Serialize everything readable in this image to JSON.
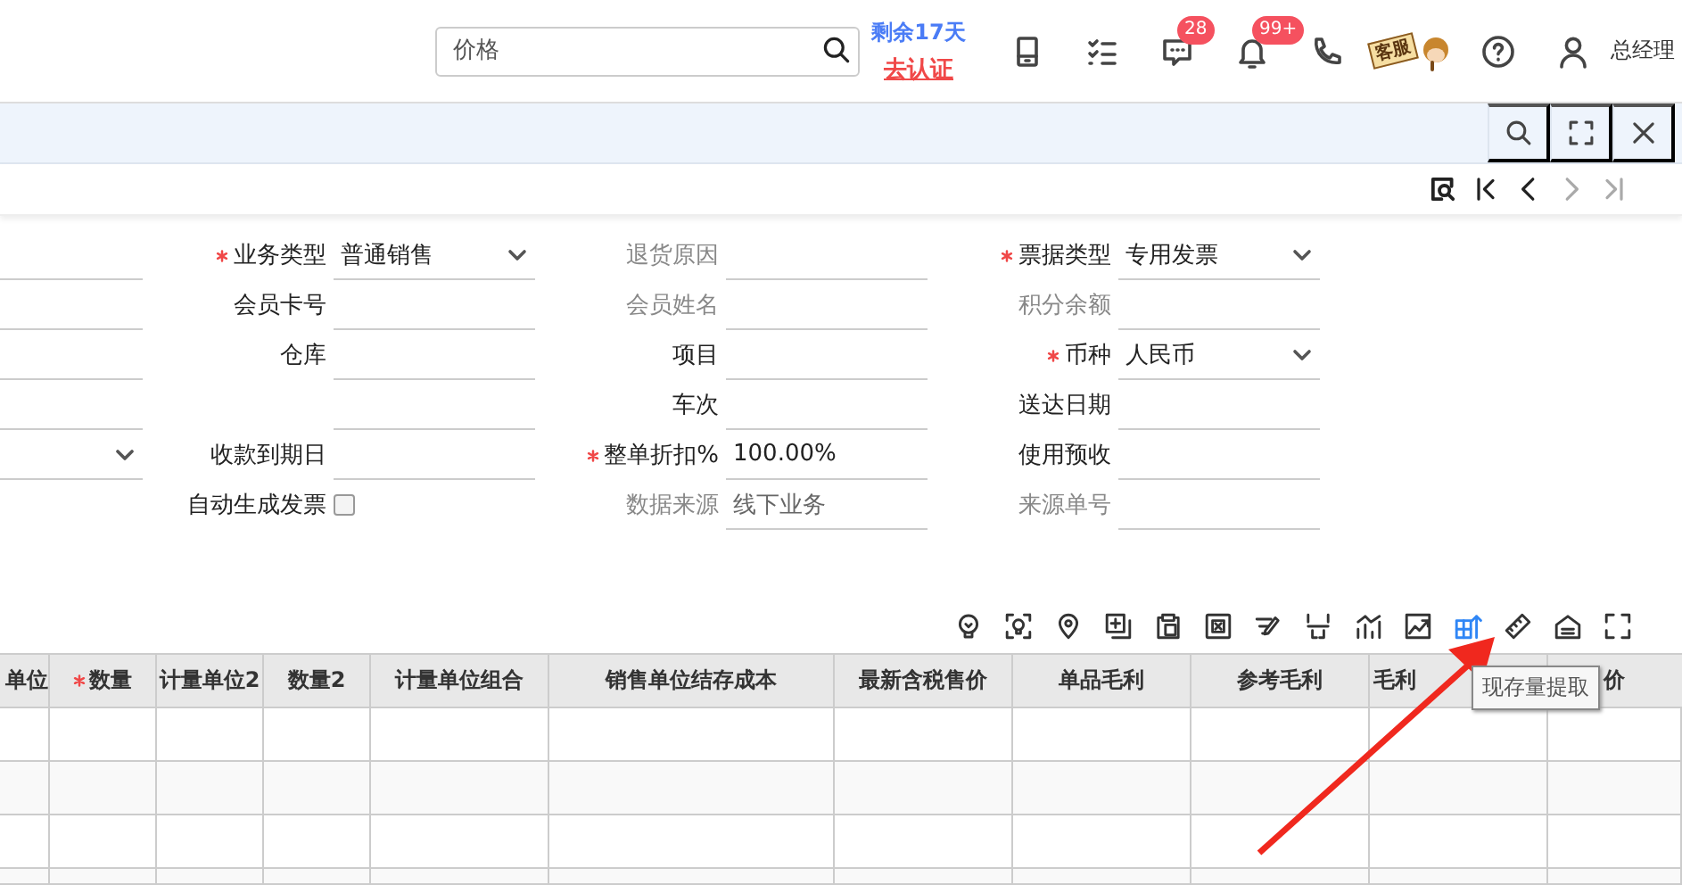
{
  "header": {
    "search": {
      "placeholder": "价格"
    },
    "trial": {
      "remaining": "剩余17天",
      "link": "去认证"
    },
    "icons": [
      {
        "kind": "tablet"
      },
      {
        "kind": "checklist"
      },
      {
        "kind": "chat",
        "badge": "28"
      },
      {
        "kind": "bell",
        "badge": "99+"
      },
      {
        "kind": "phone"
      },
      {
        "kind": "mascot",
        "sign": "客服"
      },
      {
        "kind": "help"
      },
      {
        "kind": "user"
      }
    ],
    "user": "总经理"
  },
  "panel_bar": {
    "icons": [
      {
        "kind": "search"
      },
      {
        "kind": "fullscreen"
      },
      {
        "kind": "close"
      }
    ]
  },
  "record_nav": [
    {
      "kind": "preview",
      "disabled": false
    },
    {
      "kind": "first",
      "disabled": false
    },
    {
      "kind": "prev",
      "disabled": false
    },
    {
      "kind": "next",
      "disabled": true
    },
    {
      "kind": "last",
      "disabled": true
    }
  ],
  "form": {
    "columns": [
      [
        {
          "kind": "text"
        },
        {
          "kind": "text"
        },
        {
          "kind": "text"
        },
        {
          "kind": "text"
        },
        {
          "kind": "dropdown"
        }
      ],
      [
        {
          "label": "业务类型",
          "required": true,
          "kind": "dropdown",
          "value": "普通销售"
        },
        {
          "label": "会员卡号",
          "kind": "text"
        },
        {
          "label": "仓库",
          "kind": "text"
        },
        {
          "kind": "text"
        },
        {
          "label": "收款到期日",
          "kind": "text"
        },
        {
          "label": "自动生成发票",
          "kind": "checkbox",
          "checked": false
        }
      ],
      [
        {
          "label": "退货原因",
          "readonly": true,
          "kind": "text"
        },
        {
          "label": "会员姓名",
          "readonly": true,
          "kind": "text"
        },
        {
          "label": "项目",
          "kind": "text"
        },
        {
          "label": "车次",
          "kind": "text"
        },
        {
          "label": "整单折扣%",
          "required": true,
          "kind": "text",
          "value": "100.00%"
        },
        {
          "label": "数据来源",
          "readonly": true,
          "kind": "text",
          "value": "线下业务"
        }
      ],
      [
        {
          "label": "票据类型",
          "required": true,
          "kind": "dropdown",
          "value": "专用发票"
        },
        {
          "label": "积分余额",
          "readonly": true,
          "kind": "text"
        },
        {
          "label": "币种",
          "required": true,
          "kind": "dropdown",
          "value": "人民币"
        },
        {
          "label": "送达日期",
          "kind": "text"
        },
        {
          "label": "使用预收",
          "kind": "text"
        },
        {
          "label": "来源单号",
          "readonly": true,
          "kind": "text"
        }
      ]
    ]
  },
  "toolbar": {
    "tools": [
      {
        "kind": "bulb",
        "hovered": false
      },
      {
        "kind": "scan",
        "hovered": false
      },
      {
        "kind": "pin",
        "hovered": false
      },
      {
        "kind": "add",
        "hovered": false
      },
      {
        "kind": "paste",
        "hovered": false
      },
      {
        "kind": "remove",
        "hovered": false
      },
      {
        "kind": "edit",
        "hovered": false
      },
      {
        "kind": "split",
        "hovered": false
      },
      {
        "kind": "bars",
        "hovered": false
      },
      {
        "kind": "trend",
        "hovered": false
      },
      {
        "kind": "stock",
        "hovered": true,
        "tooltip": "现存量提取"
      },
      {
        "kind": "ruler",
        "hovered": false
      },
      {
        "kind": "house",
        "hovered": false
      },
      {
        "kind": "expand",
        "hovered": false
      }
    ]
  },
  "table": {
    "columns": [
      {
        "label": "单位"
      },
      {
        "label": "数量",
        "required": true
      },
      {
        "label": "计量单位2"
      },
      {
        "label": "数量2"
      },
      {
        "label": "计量单位组合"
      },
      {
        "label": "销售单位结存成本"
      },
      {
        "label": "最新含税售价"
      },
      {
        "label": "单品毛利"
      },
      {
        "label": "参考毛利"
      },
      {
        "label": "毛利"
      },
      {
        "label": "价"
      }
    ]
  }
}
